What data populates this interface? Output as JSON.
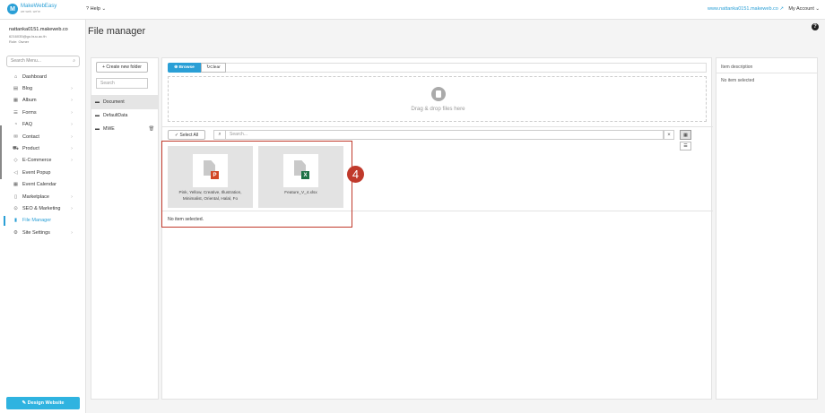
{
  "header": {
    "logo_name": "MakeWebEasy",
    "logo_sub": "we web. we're",
    "help_label": "Help",
    "site_url": "www.nattanka0151.makeweb.co",
    "account_label": "My Account"
  },
  "user": {
    "email": "nattanka0151.makeweb.co",
    "line2": "6216035@go.buu.ac.th",
    "line3": "Role: Owner"
  },
  "sidebar": {
    "search_placeholder": "Search Menu...",
    "items": [
      {
        "label": "Dashboard",
        "icon": "home-icon",
        "glyph": "⌂",
        "chevron": false
      },
      {
        "label": "Blog",
        "icon": "blog-icon",
        "glyph": "▤",
        "chevron": true
      },
      {
        "label": "Album",
        "icon": "album-icon",
        "glyph": "▦",
        "chevron": true
      },
      {
        "label": "Forms",
        "icon": "forms-icon",
        "glyph": "☰",
        "chevron": true
      },
      {
        "label": "FAQ",
        "icon": "faq-icon",
        "glyph": "◔",
        "chevron": true
      },
      {
        "label": "Contact",
        "icon": "contact-icon",
        "glyph": "✉",
        "chevron": true
      },
      {
        "label": "Product",
        "icon": "cart-icon",
        "glyph": "⛟",
        "chevron": true
      },
      {
        "label": "E-Commerce",
        "icon": "tag-icon",
        "glyph": "◇",
        "chevron": true
      },
      {
        "label": "Event Popup",
        "icon": "megaphone-icon",
        "glyph": "◁",
        "chevron": false
      },
      {
        "label": "Event Calendar",
        "icon": "calendar-icon",
        "glyph": "▦",
        "chevron": false
      },
      {
        "label": "Marketplace",
        "icon": "marketplace-icon",
        "glyph": "▯",
        "chevron": true
      },
      {
        "label": "SEO & Marketing",
        "icon": "seo-icon",
        "glyph": "⊙",
        "chevron": true
      },
      {
        "label": "File Manager",
        "icon": "file-manager-icon",
        "glyph": "▮",
        "chevron": false,
        "active": true
      },
      {
        "label": "Site Settings",
        "icon": "gear-icon",
        "glyph": "⚙",
        "chevron": true
      }
    ],
    "design_button": "Design Website"
  },
  "page": {
    "title": "File manager"
  },
  "folders": {
    "create_label": "Create new folder",
    "search_placeholder": "Search",
    "items": [
      "Document",
      "DefaultData",
      "MWE"
    ]
  },
  "toolbar": {
    "browse_label": "Browse",
    "clear_label": "Clear",
    "drop_text": "Drag & drop files here",
    "select_all_label": "Select All",
    "search_placeholder": "Search...",
    "clear_x": "×"
  },
  "files": [
    {
      "name": "Pink, Yellow, Creative, Illustration, Minimalist, Oriental, Halal, Fo",
      "type": "pptx",
      "badge": "P",
      "badge_color": "#d24726"
    },
    {
      "name": "Feature_V_4.xlsx",
      "type": "xlsx",
      "badge": "X",
      "badge_color": "#1e7145"
    }
  ],
  "annotation": {
    "step": "4",
    "color": "#c0392b"
  },
  "status": {
    "no_item_selected": "No item selected."
  },
  "description": {
    "title": "Item description",
    "empty": "No item selected"
  },
  "colors": {
    "accent": "#2a9fd6",
    "design_button": "#2fb3e0"
  }
}
